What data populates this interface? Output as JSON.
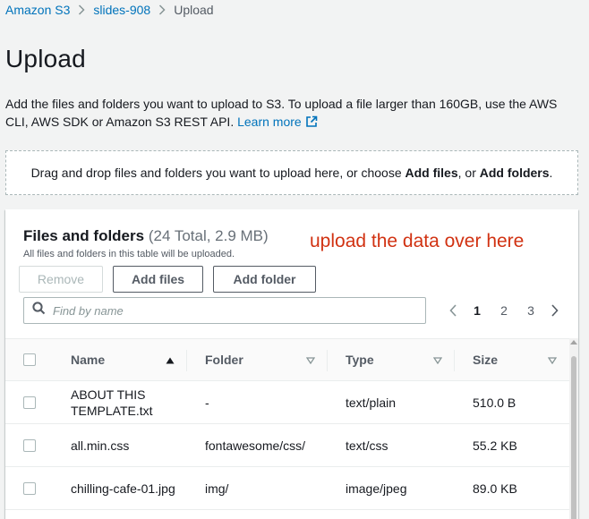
{
  "breadcrumb": {
    "items": [
      "Amazon S3",
      "slides-908",
      "Upload"
    ]
  },
  "page": {
    "title": "Upload",
    "description_text": "Add the files and folders you want to upload to S3. To upload a file larger than 160GB, use the AWS CLI, AWS SDK or Amazon S3 REST API.",
    "learn_more": "Learn more"
  },
  "dropzone": {
    "text_prefix": "Drag and drop files and folders you want to upload here, or choose",
    "add_files": "Add files",
    "or": ", or",
    "add_folders": "Add folders",
    "suffix": "."
  },
  "panel": {
    "title": "Files and folders",
    "counter": "(24 Total, 2.9 MB)",
    "subtitle": "All files and folders in this table will be uploaded.",
    "annotation": "upload the data over here"
  },
  "buttons": {
    "remove": "Remove",
    "add_files": "Add files",
    "add_folder": "Add folder"
  },
  "search": {
    "placeholder": "Find by name",
    "value": ""
  },
  "pagination": {
    "pages": [
      "1",
      "2",
      "3"
    ],
    "current": "1"
  },
  "table": {
    "columns": [
      "Name",
      "Folder",
      "Type",
      "Size"
    ],
    "rows": [
      {
        "name": "ABOUT THIS TEMPLATE.txt",
        "folder": "-",
        "type": "text/plain",
        "size": "510.0 B"
      },
      {
        "name": "all.min.css",
        "folder": "fontawesome/css/",
        "type": "text/css",
        "size": "55.2 KB"
      },
      {
        "name": "chilling-cafe-01.jpg",
        "folder": "img/",
        "type": "image/jpeg",
        "size": "89.0 KB"
      }
    ]
  },
  "colors": {
    "link": "#0073bb",
    "annotation": "#d13212",
    "background": "#f2f3f3"
  },
  "icons": {
    "breadcrumb_separator": "chevron-right-icon",
    "external_link": "external-link-icon",
    "search": "search-icon",
    "sort_asc": "caret-up-icon",
    "filter": "caret-down-outline-icon"
  }
}
